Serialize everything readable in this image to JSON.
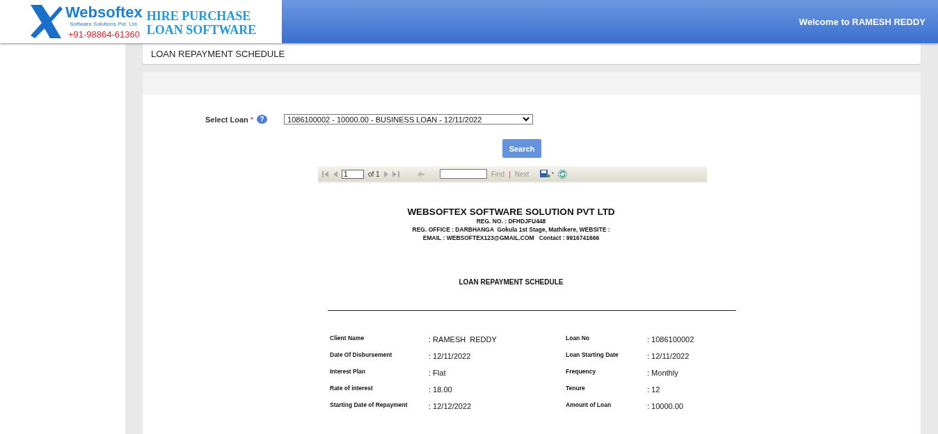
{
  "header": {
    "brand": "Websoftex",
    "brand_sub": "Software Solutions Pvt. Ltd.",
    "phone": "+91-98864-61360",
    "product_line1": "HIRE PURCHASE",
    "product_line2": "LOAN SOFTWARE",
    "welcome": "Welcome to RAMESH REDDY"
  },
  "page_title": "LOAN REPAYMENT SCHEDULE",
  "form": {
    "label": "Select Loan",
    "required_mark": "*",
    "help": "?",
    "select_value": "1086100002 - 10000.00 - BUSINESS LOAN - 12/11/2022",
    "button": "Search"
  },
  "report_toolbar": {
    "page": "1",
    "of": "of 1",
    "find": "Find",
    "separator": "|",
    "next": "Next",
    "find_disabled": true
  },
  "report": {
    "company": "WEBSOFTEX SOFTWARE SOLUTION PVT LTD",
    "lines": [
      "REG. NO. : DFHDJFU448",
      "REG. OFFICE : DARBHANGA  Gokula 1st Stage, Mathikere, WEBSITE :",
      "EMAIL : WEBSOFTEX123@GMAIL.COM   Contact : 9916741666"
    ],
    "title": "LOAN REPAYMENT SCHEDULE",
    "details": [
      {
        "label": "Client Name",
        "value": ": RAMESH  REDDY",
        "label2": "Loan No",
        "value2": ": 1086100002"
      },
      {
        "label": "Date Of Disbursement",
        "value": ": 12/11/2022",
        "label2": "Loan Starting Date",
        "value2": ": 12/11/2022"
      },
      {
        "label": "Interest Plan",
        "value": ": Flat",
        "label2": "Frequency",
        "value2": ": Monthly"
      },
      {
        "label": "Rate of interest",
        "value": ": 18.00",
        "label2": "Tenure",
        "value2": ": 12"
      },
      {
        "label": "Starting Date of Repayment",
        "value": ": 12/12/2022",
        "label2": "Amount of Loan",
        "value2": ": 10000.00"
      }
    ]
  }
}
